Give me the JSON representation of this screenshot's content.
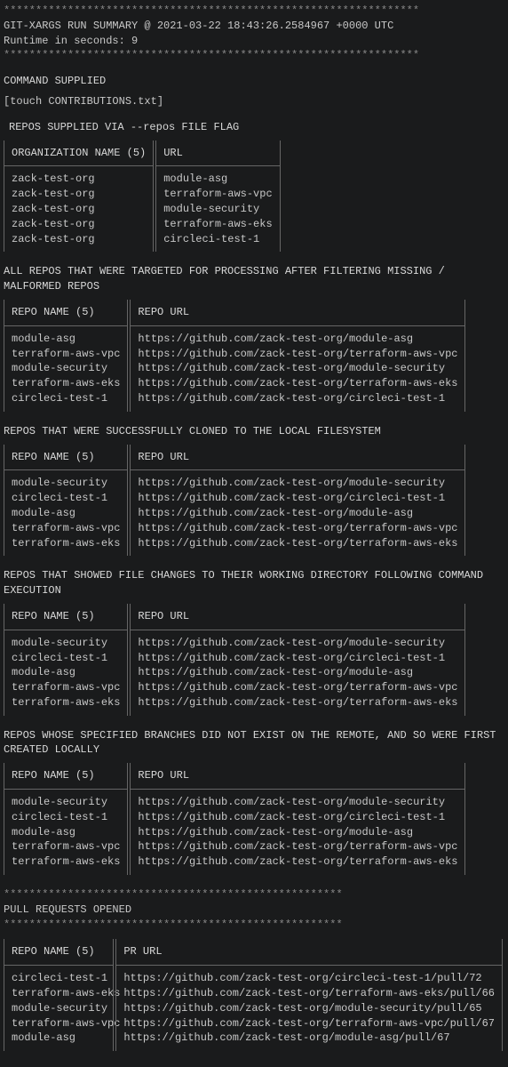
{
  "stars_top": "*****************************************************************",
  "header_line": "  GIT-XARGS RUN SUMMARY @ 2021-03-22 18:43:26.2584967 +0000 UTC",
  "runtime_line": "  Runtime in seconds: 9",
  "stars_close": "*****************************************************************",
  "command_supplied_title": "COMMAND SUPPLIED",
  "command_supplied_value": "[touch CONTRIBUTIONS.txt]",
  "repos_supplied_title": " REPOS SUPPLIED VIA --repos FILE FLAG",
  "supplied": {
    "col1_header": "ORGANIZATION NAME (5)",
    "col2_header": "URL",
    "rows": [
      {
        "org": "zack-test-org",
        "url": "module-asg"
      },
      {
        "org": "zack-test-org",
        "url": "terraform-aws-vpc"
      },
      {
        "org": "zack-test-org",
        "url": "module-security"
      },
      {
        "org": "zack-test-org",
        "url": "terraform-aws-eks"
      },
      {
        "org": "zack-test-org",
        "url": "circleci-test-1"
      }
    ]
  },
  "targeted_title": "ALL REPOS THAT WERE TARGETED FOR PROCESSING AFTER FILTERING MISSING / MALFORMED REPOS",
  "targeted": {
    "col1_header": "REPO NAME (5)",
    "col2_header": "REPO URL",
    "rows": [
      {
        "name": "module-asg",
        "url": "https://github.com/zack-test-org/module-asg"
      },
      {
        "name": "terraform-aws-vpc",
        "url": "https://github.com/zack-test-org/terraform-aws-vpc"
      },
      {
        "name": "module-security",
        "url": "https://github.com/zack-test-org/module-security"
      },
      {
        "name": "terraform-aws-eks",
        "url": "https://github.com/zack-test-org/terraform-aws-eks"
      },
      {
        "name": "circleci-test-1",
        "url": "https://github.com/zack-test-org/circleci-test-1"
      }
    ]
  },
  "cloned_title": "REPOS THAT WERE SUCCESSFULLY CLONED TO THE LOCAL FILESYSTEM",
  "cloned": {
    "col1_header": "REPO NAME (5)",
    "col2_header": "REPO URL",
    "rows": [
      {
        "name": "module-security",
        "url": "https://github.com/zack-test-org/module-security"
      },
      {
        "name": "circleci-test-1",
        "url": "https://github.com/zack-test-org/circleci-test-1"
      },
      {
        "name": "module-asg",
        "url": "https://github.com/zack-test-org/module-asg"
      },
      {
        "name": "terraform-aws-vpc",
        "url": "https://github.com/zack-test-org/terraform-aws-vpc"
      },
      {
        "name": "terraform-aws-eks",
        "url": "https://github.com/zack-test-org/terraform-aws-eks"
      }
    ]
  },
  "changes_title": "REPOS THAT SHOWED FILE CHANGES TO THEIR WORKING DIRECTORY FOLLOWING COMMAND EXECUTION",
  "changes": {
    "col1_header": "REPO NAME (5)",
    "col2_header": "REPO URL",
    "rows": [
      {
        "name": "module-security",
        "url": "https://github.com/zack-test-org/module-security"
      },
      {
        "name": "circleci-test-1",
        "url": "https://github.com/zack-test-org/circleci-test-1"
      },
      {
        "name": "module-asg",
        "url": "https://github.com/zack-test-org/module-asg"
      },
      {
        "name": "terraform-aws-vpc",
        "url": "https://github.com/zack-test-org/terraform-aws-vpc"
      },
      {
        "name": "terraform-aws-eks",
        "url": "https://github.com/zack-test-org/terraform-aws-eks"
      }
    ]
  },
  "branches_title": "REPOS WHOSE SPECIFIED BRANCHES DID NOT EXIST ON THE REMOTE, AND SO WERE FIRST CREATED LOCALLY",
  "branches": {
    "col1_header": "REPO NAME (5)",
    "col2_header": "REPO URL",
    "rows": [
      {
        "name": "module-security",
        "url": "https://github.com/zack-test-org/module-security"
      },
      {
        "name": "circleci-test-1",
        "url": "https://github.com/zack-test-org/circleci-test-1"
      },
      {
        "name": "module-asg",
        "url": "https://github.com/zack-test-org/module-asg"
      },
      {
        "name": "terraform-aws-vpc",
        "url": "https://github.com/zack-test-org/terraform-aws-vpc"
      },
      {
        "name": "terraform-aws-eks",
        "url": "https://github.com/zack-test-org/terraform-aws-eks"
      }
    ]
  },
  "prs_stars": "*****************************************************",
  "prs_title": "  PULL REQUESTS OPENED",
  "prs_stars2": "*****************************************************",
  "prs": {
    "col1_header": "REPO NAME (5)",
    "col2_header": "PR URL",
    "rows": [
      {
        "name": "circleci-test-1",
        "url": "https://github.com/zack-test-org/circleci-test-1/pull/72"
      },
      {
        "name": "terraform-aws-eks",
        "url": "https://github.com/zack-test-org/terraform-aws-eks/pull/66"
      },
      {
        "name": "module-security",
        "url": "https://github.com/zack-test-org/module-security/pull/65"
      },
      {
        "name": "terraform-aws-vpc",
        "url": "https://github.com/zack-test-org/terraform-aws-vpc/pull/67"
      },
      {
        "name": "module-asg",
        "url": "https://github.com/zack-test-org/module-asg/pull/67"
      }
    ]
  }
}
